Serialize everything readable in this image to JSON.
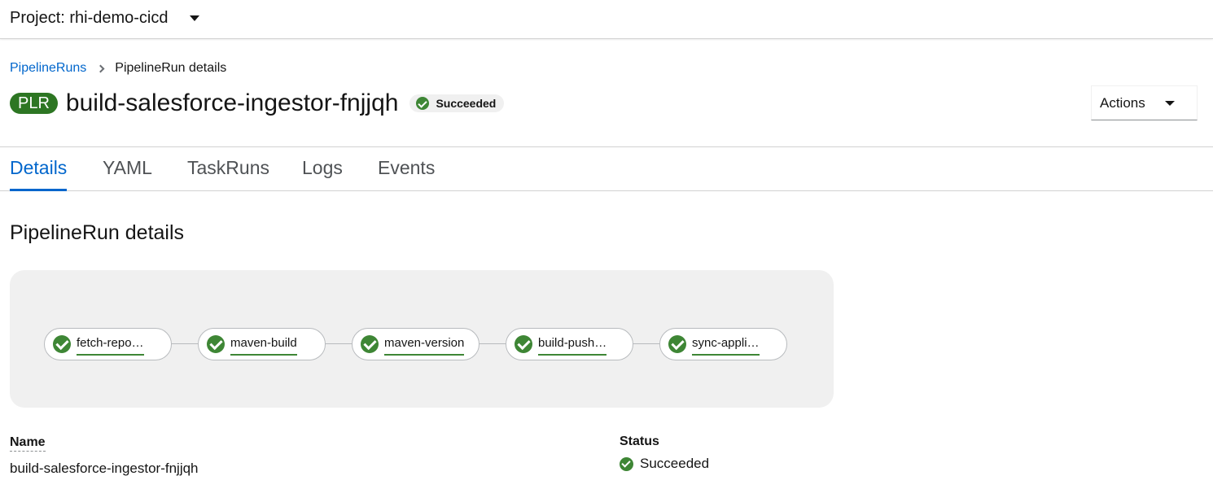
{
  "project_bar": {
    "label": "Project: rhi-demo-cicd"
  },
  "breadcrumb": {
    "link": "PipelineRuns",
    "current": "PipelineRun details"
  },
  "header": {
    "kind_badge": "PLR",
    "title": "build-salesforce-ingestor-fnjjqh",
    "status": "Succeeded",
    "actions_label": "Actions"
  },
  "tabs": [
    {
      "label": "Details",
      "active": true
    },
    {
      "label": "YAML",
      "active": false
    },
    {
      "label": "TaskRuns",
      "active": false
    },
    {
      "label": "Logs",
      "active": false
    },
    {
      "label": "Events",
      "active": false
    }
  ],
  "section_title": "PipelineRun details",
  "pipeline": {
    "tasks": [
      {
        "label": "fetch-repo…",
        "status": "succeeded"
      },
      {
        "label": "maven-build",
        "status": "succeeded"
      },
      {
        "label": "maven-version",
        "status": "succeeded"
      },
      {
        "label": "build-push…",
        "status": "succeeded"
      },
      {
        "label": "sync-appli…",
        "status": "succeeded"
      }
    ]
  },
  "details": {
    "name_label": "Name",
    "name_value": "build-salesforce-ingestor-fnjjqh",
    "status_label": "Status",
    "status_value": "Succeeded"
  },
  "colors": {
    "success": "#3e8635",
    "badge": "#2d7623",
    "link": "#0066cc"
  }
}
